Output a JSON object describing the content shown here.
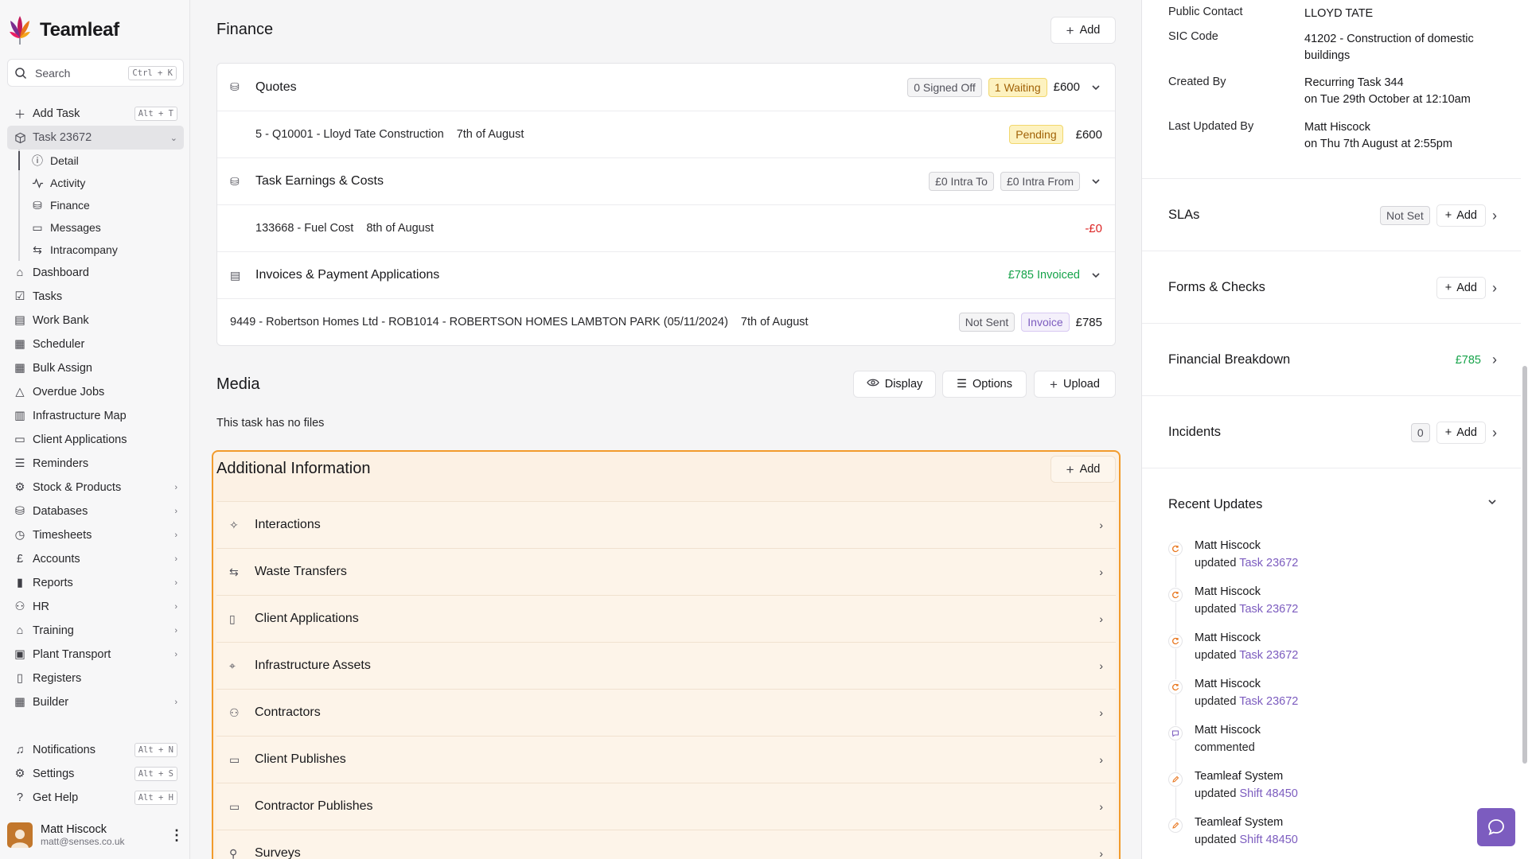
{
  "brand": {
    "name": "Teamleaf"
  },
  "search": {
    "label": "Search",
    "shortcut": "Ctrl + K"
  },
  "nav": {
    "add_task": {
      "label": "Add Task",
      "shortcut": "Alt + T"
    },
    "task": {
      "label": "Task 23672"
    },
    "task_sub": [
      "Detail",
      "Activity",
      "Finance",
      "Messages",
      "Intracompany"
    ],
    "items": [
      "Dashboard",
      "Tasks",
      "Work Bank",
      "Scheduler",
      "Bulk Assign",
      "Overdue Jobs",
      "Infrastructure Map",
      "Client Applications",
      "Reminders",
      "Stock & Products",
      "Databases",
      "Timesheets",
      "Accounts",
      "Reports",
      "HR",
      "Training",
      "Plant Transport",
      "Registers",
      "Builder"
    ],
    "bottom": [
      {
        "label": "Notifications",
        "shortcut": "Alt + N"
      },
      {
        "label": "Settings",
        "shortcut": "Alt + S"
      },
      {
        "label": "Get Help",
        "shortcut": "Alt + H"
      }
    ]
  },
  "user": {
    "name": "Matt Hiscock",
    "email": "matt@senses.co.uk"
  },
  "finance": {
    "title": "Finance",
    "add_label": "Add",
    "quotes": {
      "title": "Quotes",
      "signed_off": "0 Signed Off",
      "waiting": "1 Waiting",
      "total": "£600"
    },
    "quote_row": {
      "desc": "5 - Q10001 - Lloyd Tate Construction",
      "date": "7th of August",
      "status": "Pending",
      "amount": "£600"
    },
    "earnings": {
      "title": "Task Earnings & Costs",
      "intra_to": "£0 Intra To",
      "intra_from": "£0 Intra From"
    },
    "earning_row": {
      "desc": "133668 - Fuel Cost",
      "date": "8th of August",
      "amount": "-£0"
    },
    "invoices": {
      "title": "Invoices & Payment Applications",
      "invoiced": "£785 Invoiced"
    },
    "invoice_row": {
      "desc": "9449 - Robertson Homes Ltd - ROB1014 - ROBERTSON HOMES LAMBTON PARK (05/11/2024)",
      "date": "7th of August",
      "status1": "Not Sent",
      "status2": "Invoice",
      "amount": "£785"
    }
  },
  "media": {
    "title": "Media",
    "display": "Display",
    "options": "Options",
    "upload": "Upload",
    "empty": "This task has no files"
  },
  "additional": {
    "title": "Additional Information",
    "add_label": "Add",
    "rows": [
      "Interactions",
      "Waste Transfers",
      "Client Applications",
      "Infrastructure Assets",
      "Contractors",
      "Client Publishes",
      "Contractor Publishes",
      "Surveys"
    ]
  },
  "details": {
    "public_contact": {
      "label": "Public Contact",
      "value": "LLOYD TATE"
    },
    "sic_code": {
      "label": "SIC Code",
      "value": "41202 - Construction of domestic buildings"
    },
    "created_by": {
      "label": "Created By",
      "value": "Recurring Task 344",
      "when": "on Tue 29th October at 12:10am"
    },
    "updated_by": {
      "label": "Last Updated By",
      "value": "Matt Hiscock",
      "when": "on Thu 7th August at 2:55pm"
    }
  },
  "right_sections": {
    "slas": {
      "title": "SLAs",
      "status": "Not Set",
      "add": "Add"
    },
    "forms": {
      "title": "Forms & Checks",
      "add": "Add"
    },
    "breakdown": {
      "title": "Financial Breakdown",
      "value": "£785"
    },
    "incidents": {
      "title": "Incidents",
      "count": "0",
      "add": "Add"
    },
    "recent": {
      "title": "Recent Updates"
    }
  },
  "updates": [
    {
      "name": "Matt Hiscock",
      "action": "updated",
      "link": "Task 23672",
      "icon": "refresh-icon"
    },
    {
      "name": "Matt Hiscock",
      "action": "updated",
      "link": "Task 23672",
      "icon": "refresh-icon"
    },
    {
      "name": "Matt Hiscock",
      "action": "updated",
      "link": "Task 23672",
      "icon": "refresh-icon"
    },
    {
      "name": "Matt Hiscock",
      "action": "updated",
      "link": "Task 23672",
      "icon": "refresh-icon"
    },
    {
      "name": "Matt Hiscock",
      "action": "commented",
      "link": "",
      "icon": "comment-icon"
    },
    {
      "name": "Teamleaf System",
      "action": "updated",
      "link": "Shift 48450",
      "icon": "pencil-icon"
    },
    {
      "name": "Teamleaf System",
      "action": "updated",
      "link": "Shift 48450",
      "icon": "pencil-icon"
    }
  ],
  "colors": {
    "accent": "#7c5cbf",
    "highlight_border": "#f29b2c",
    "highlight_bg": "#fcf1e4",
    "negative": "#dc2626",
    "positive": "#16a34a"
  }
}
